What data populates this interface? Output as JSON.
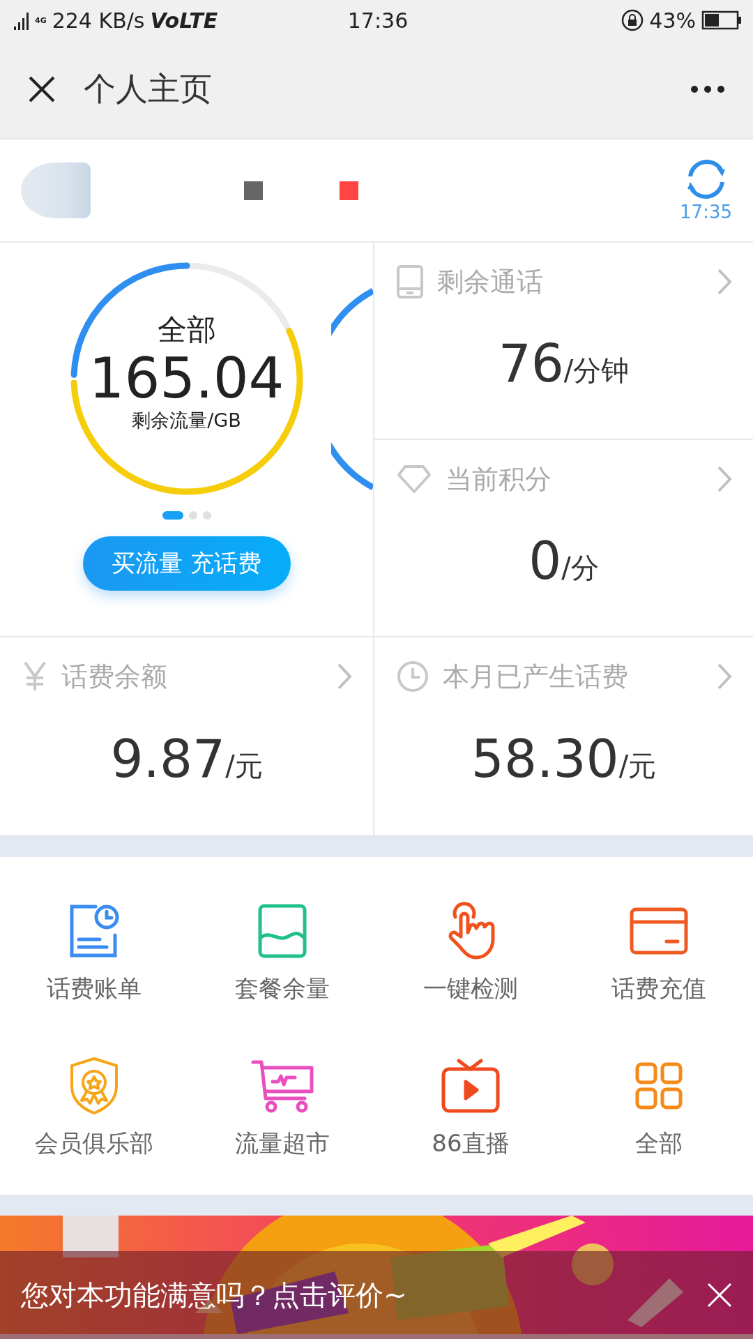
{
  "status_bar": {
    "network": "4G",
    "speed": "224 KB/s",
    "volte": "VoLTE",
    "time": "17:36",
    "battery": "43%"
  },
  "header": {
    "title": "个人主页"
  },
  "account": {
    "refresh_time": "17:35"
  },
  "data_card": {
    "label": "全部",
    "value": "165.04",
    "unit": "剩余流量/GB",
    "pages": [
      {
        "selected": true
      },
      {
        "selected": false
      },
      {
        "selected": false
      }
    ],
    "button": "买流量 充话费"
  },
  "stats": [
    {
      "label": "剩余通话",
      "value": "76",
      "unit": "/分钟"
    },
    {
      "label": "当前积分",
      "value": "0",
      "unit": "/分"
    },
    {
      "label": "话费余额",
      "value": "9.87",
      "unit": "/元"
    },
    {
      "label": "本月已产生话费",
      "value": "58.30",
      "unit": "/元"
    }
  ],
  "services": [
    {
      "label": "话费账单"
    },
    {
      "label": "套餐余量"
    },
    {
      "label": "一键检测"
    },
    {
      "label": "话费充值"
    },
    {
      "label": "会员俱乐部"
    },
    {
      "label": "流量超市"
    },
    {
      "label": "86直播"
    },
    {
      "label": "全部"
    }
  ],
  "feedback": {
    "text": "您对本功能满意吗？点击评价~"
  }
}
